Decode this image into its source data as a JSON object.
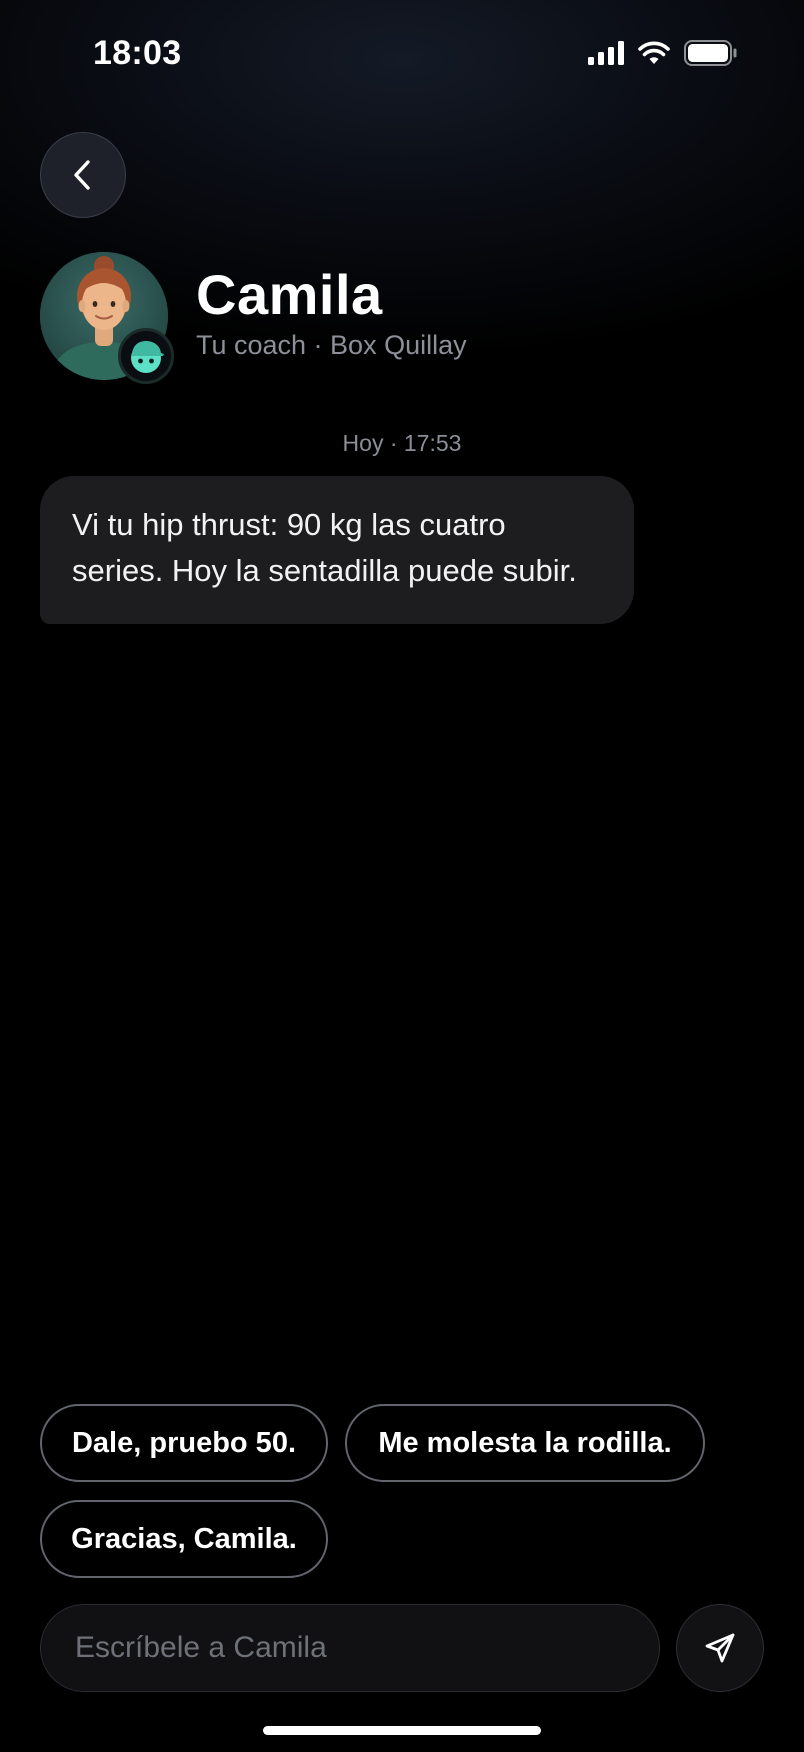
{
  "status_bar": {
    "time": "18:03",
    "icons": [
      "signal-icon",
      "wifi-icon",
      "battery-icon"
    ]
  },
  "header": {
    "back_icon": "chevron-left-icon",
    "name": "Camila",
    "subtitle": "Tu coach · Box Quillay",
    "avatar_badge_icon": "mascot-icon"
  },
  "chat": {
    "timestamp": "Hoy · 17:53",
    "messages": [
      {
        "sender": "Camila",
        "text": "Vi tu hip thrust: 90 kg las cuatro series. Hoy la sentadilla puede subir."
      }
    ]
  },
  "quick_replies": [
    "Dale, pruebo 50.",
    "Me molesta la rodilla.",
    "Gracias, Camila."
  ],
  "composer": {
    "placeholder": "Escríbele a Camila",
    "value": "",
    "send_icon": "send-icon"
  },
  "colors": {
    "background": "#000000",
    "bubble": "#1d1d1f",
    "muted_text": "#8d9099",
    "badge_accent": "#5ce0c6"
  }
}
